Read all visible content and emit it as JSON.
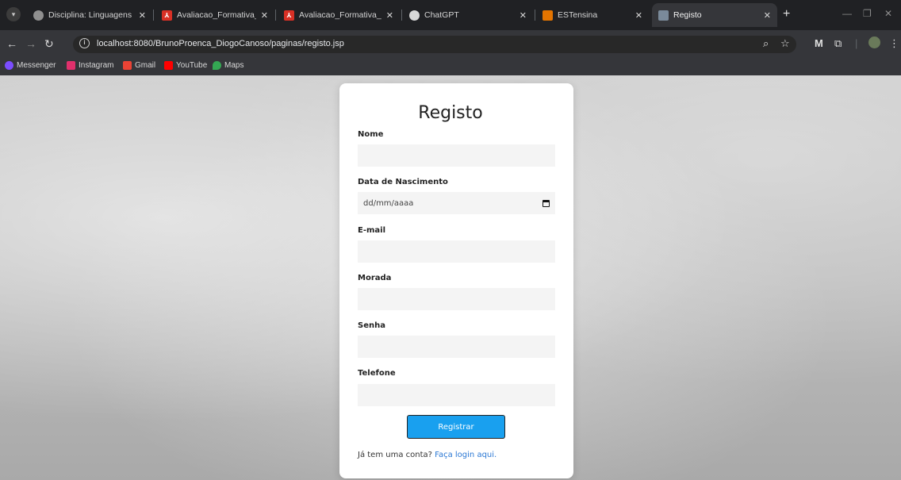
{
  "browser": {
    "tabs": [
      {
        "title": "Disciplina: Linguagens de I",
        "favicon": "globe-icon"
      },
      {
        "title": "Avaliacao_Formativa_LPI_L",
        "favicon": "pdf-icon"
      },
      {
        "title": "Avaliacao_Formativa_LPI_L",
        "favicon": "pdf-icon"
      },
      {
        "title": "ChatGPT",
        "favicon": "chatgpt-icon"
      },
      {
        "title": "ESTensina",
        "favicon": "es-icon"
      },
      {
        "title": "Registo",
        "favicon": "registo-favicon",
        "active": true
      }
    ],
    "url": "localhost:8080/BrunoProenca_DiogoCanoso/paginas/registo.jsp",
    "bookmarks": [
      {
        "label": "Messenger",
        "icon": "messenger-icon",
        "color": "#7b4dff"
      },
      {
        "label": "Instagram",
        "icon": "instagram-icon",
        "color": "#e1306c"
      },
      {
        "label": "Gmail",
        "icon": "gmail-icon",
        "color": "#ea4335"
      },
      {
        "label": "YouTube",
        "icon": "youtube-icon",
        "color": "#ff0000"
      },
      {
        "label": "Maps",
        "icon": "maps-icon",
        "color": "#34a853"
      }
    ]
  },
  "form": {
    "title": "Registo",
    "fields": [
      {
        "label": "Nome",
        "value": ""
      },
      {
        "label": "Data de Nascimento",
        "placeholder": "dd/mm/aaaa"
      },
      {
        "label": "E-mail",
        "value": ""
      },
      {
        "label": "Morada",
        "value": ""
      },
      {
        "label": "Senha",
        "value": ""
      },
      {
        "label": "Telefone",
        "value": ""
      }
    ],
    "submit_label": "Registrar",
    "login_prompt": "Já tem uma conta?",
    "login_link": "Faça login aqui."
  },
  "colors": {
    "button": "#19a0ef",
    "link": "#2b78d4",
    "tab_bar": "#202124",
    "toolbar": "#35363a"
  }
}
